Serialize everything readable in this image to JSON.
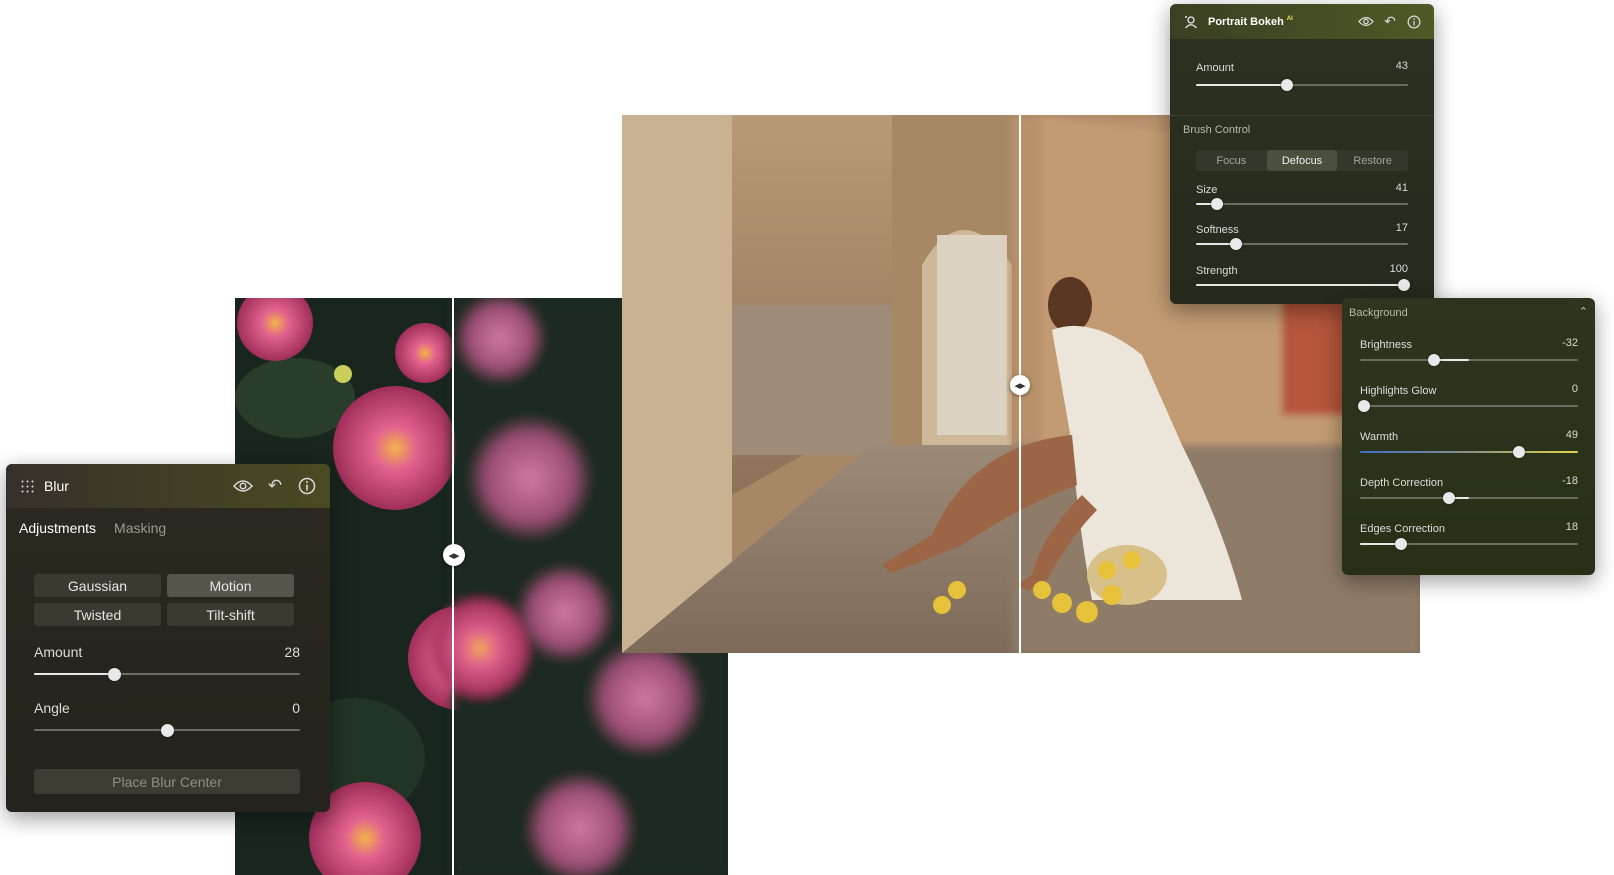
{
  "blur_panel": {
    "title": "Blur",
    "icon": "grid-dots-icon",
    "actions": [
      "eye-icon",
      "undo-icon",
      "info-icon"
    ],
    "tabs": [
      {
        "label": "Adjustments",
        "active": true
      },
      {
        "label": "Masking",
        "active": false
      }
    ],
    "modes": [
      {
        "label": "Gaussian",
        "active": false
      },
      {
        "label": "Motion",
        "active": true
      },
      {
        "label": "Twisted",
        "active": false
      },
      {
        "label": "Tilt-shift",
        "active": false
      }
    ],
    "sliders": [
      {
        "label": "Amount",
        "value": "28",
        "position": 0.3
      },
      {
        "label": "Angle",
        "value": "0",
        "position": 0.5,
        "bipolar": true
      }
    ],
    "place_button": "Place Blur Center"
  },
  "bokeh_panel": {
    "title": "Portrait Bokeh",
    "badge": "AI",
    "icon": "portrait-icon",
    "actions": [
      "eye-icon",
      "undo-icon",
      "info-icon"
    ],
    "amount": {
      "label": "Amount",
      "value": "43",
      "position": 0.43
    },
    "brush_title": "Brush Control",
    "brush_modes": [
      {
        "label": "Focus",
        "active": false
      },
      {
        "label": "Defocus",
        "active": true
      },
      {
        "label": "Restore",
        "active": false
      }
    ],
    "brush_sliders": [
      {
        "label": "Size",
        "value": "41",
        "position": 0.1
      },
      {
        "label": "Softness",
        "value": "17",
        "position": 0.19
      },
      {
        "label": "Strength",
        "value": "100",
        "position": 0.98
      }
    ]
  },
  "background_panel": {
    "title": "Background",
    "collapse_icon": "chevron-up-icon",
    "sliders": [
      {
        "label": "Brightness",
        "value": "-32",
        "position": 0.34,
        "bipolar": true
      },
      {
        "label": "Highlights Glow",
        "value": "0",
        "position": 0.02
      },
      {
        "label": "Warmth",
        "value": "49",
        "position": 0.73,
        "bipolar": true,
        "warm": true
      },
      {
        "label": "Depth Correction",
        "value": "-18",
        "position": 0.41,
        "bipolar": true
      },
      {
        "label": "Edges Correction",
        "value": "18",
        "position": 0.19
      }
    ]
  },
  "colors": {
    "warm_track": "#e4d54a",
    "cool_track": "#3f6fd0",
    "thumb": "#e9e9e9"
  }
}
